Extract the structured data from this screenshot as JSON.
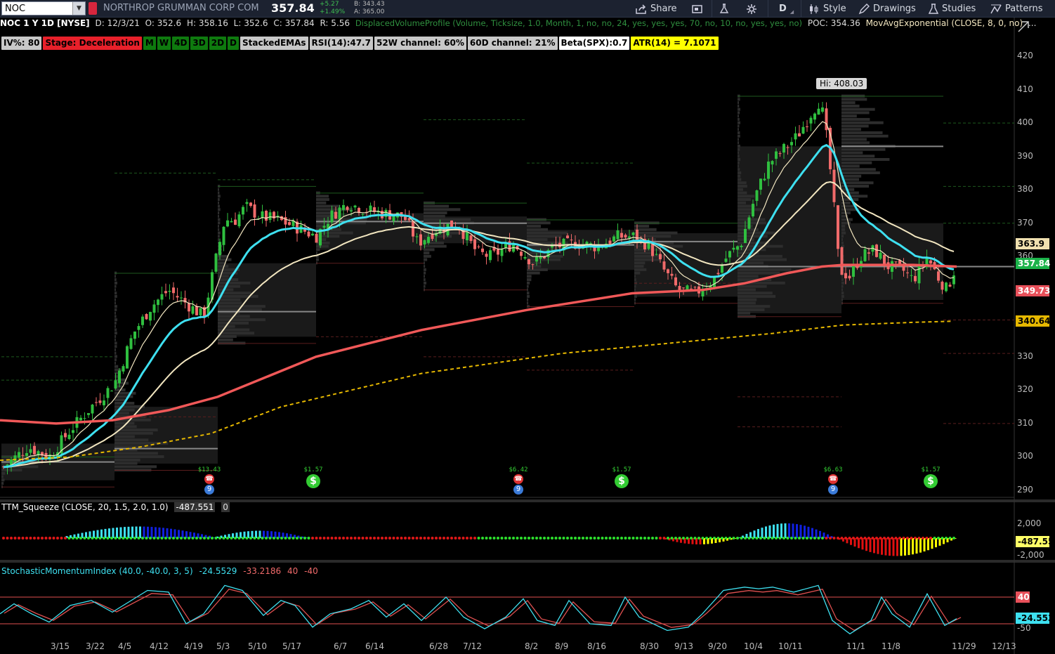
{
  "symbol": "NOC",
  "company": "NORTHROP GRUMMAN CORP COM",
  "last_price": "357.84",
  "change": "+5.27",
  "change_pct": "+1.49%",
  "bid": "B: 343.43",
  "ask": "A: 365.00",
  "toolbar": {
    "share": "Share",
    "style": "Style",
    "drawings": "Drawings",
    "studies": "Studies",
    "patterns": "Patterns",
    "timeframe": "D"
  },
  "header": {
    "title": "NOC 1 Y 1D [NYSE]",
    "date": "D: 12/3/21",
    "open": "O: 352.6",
    "high": "H: 358.16",
    "low": "L: 352.6",
    "close": "C: 357.84",
    "range": "R: 5.56",
    "dvp": "DisplacedVolumeProfile (Volume, Ticksize, 1.0, Month, 1, no, no, 24, yes, yes, yes, 70, no, 10, no, yes, yes, no)",
    "poc": "POC: 354.36",
    "ema": "MovAvgExponential (CLOSE, 8, 0, no)",
    "more": "..."
  },
  "labels": [
    {
      "text": "IV%: 80",
      "bg": "#c8c8c8",
      "fg": "#000"
    },
    {
      "text": "Stage: Deceleration",
      "bg": "#e8202a",
      "fg": "#000"
    },
    {
      "text": "M",
      "bg": "#0e7a0e",
      "fg": "#000"
    },
    {
      "text": "W",
      "bg": "#0e7a0e",
      "fg": "#000"
    },
    {
      "text": "4D",
      "bg": "#0e7a0e",
      "fg": "#000"
    },
    {
      "text": "3D",
      "bg": "#0e7a0e",
      "fg": "#000"
    },
    {
      "text": "2D",
      "bg": "#0e7a0e",
      "fg": "#000"
    },
    {
      "text": "D",
      "bg": "#0e7a0e",
      "fg": "#000"
    },
    {
      "text": "StackedEMAs",
      "bg": "#c8c8c8",
      "fg": "#000"
    },
    {
      "text": "RSI(14):47.7",
      "bg": "#c8c8c8",
      "fg": "#000"
    },
    {
      "text": "52W channel: 60%",
      "bg": "#c8c8c8",
      "fg": "#000"
    },
    {
      "text": "60D channel: 21%",
      "bg": "#c8c8c8",
      "fg": "#000"
    },
    {
      "text": "Beta(SPX):0.7",
      "bg": "#ffffff",
      "fg": "#000"
    },
    {
      "text": "ATR(14) = 7.1071",
      "bg": "#ffff00",
      "fg": "#000"
    }
  ],
  "price_axis": [
    "420",
    "410",
    "400",
    "390",
    "380",
    "370",
    "360",
    "350",
    "340",
    "330",
    "320",
    "310",
    "300",
    "290"
  ],
  "price_tags": [
    {
      "text": "363.9",
      "bg": "#f0e0b0",
      "fg": "#000"
    },
    {
      "text": "357.84",
      "bg": "#1bb34a",
      "fg": "#fff"
    },
    {
      "text": "349.73",
      "bg": "#e8505a",
      "fg": "#fff"
    },
    {
      "text": "340.64",
      "bg": "#e6b800",
      "fg": "#000"
    }
  ],
  "hi_label": "Hi: 408.03",
  "dividends": [
    "$13.43",
    "$1.57",
    "$6.42",
    "$1.57",
    "$6.63",
    "$1.57"
  ],
  "squeeze": {
    "title": "TTM_Squeeze (CLOSE, 20, 1.5, 2.0, 1.0)",
    "value": "-487.551",
    "zero": "0",
    "axis": [
      "2,000",
      "-2,000"
    ],
    "tag": "-487.55"
  },
  "smi": {
    "title": "StochasticMomentumIndex (40.0, -40.0, 3, 5)",
    "v1": "-24.5529",
    "v2": "-33.2186",
    "v3": "40",
    "v4": "-40",
    "axis_top": "40",
    "axis_bot": "-50",
    "tag": "-24.553"
  },
  "dates": [
    "3/15",
    "3/22",
    "4/5",
    "4/12",
    "4/19",
    "5/3",
    "5/10",
    "5/17",
    "6/7",
    "6/14",
    "6/28",
    "7/12",
    "8/2",
    "8/9",
    "8/16",
    "8/30",
    "9/13",
    "9/20",
    "10/4",
    "10/11",
    "11/1",
    "11/8",
    "11/29",
    "12/13"
  ],
  "colors": {
    "ema8": "#f2e6c0",
    "ema21": "#3ee0f0",
    "ema200": "#f05858",
    "sma": "#e6b800",
    "up": "#2fbf3f",
    "down": "#f06a6a"
  }
}
